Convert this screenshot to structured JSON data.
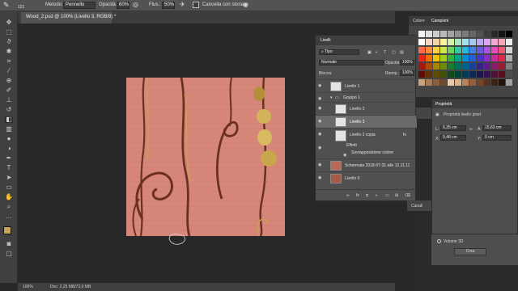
{
  "options_bar": {
    "tool_size": "121",
    "method_label": "Metodo:",
    "method_value": "Pennello",
    "opacity_label": "Opacità:",
    "opacity_value": "60%",
    "flow_label": "Flus.:",
    "flow_value": "50%",
    "history_label": "Cancella con storia"
  },
  "document": {
    "tab_title": "Wood_2.psd @ 100% (Livello 3, RGB/8) *",
    "zoom": "100%",
    "doc_info": "Doc: 2,25 MB/72,0 MB"
  },
  "layers_panel": {
    "title": "Livelli",
    "filter_label": "Tipo",
    "blend_mode": "Normale",
    "opacity_label": "Opacità:",
    "opacity_value": "100%",
    "fill_label": "Riemp.:",
    "fill_value": "100%",
    "lock_label": "Blocca:",
    "layers": [
      {
        "name": "Livello 1"
      },
      {
        "name": "Gruppo 1"
      },
      {
        "name": "Livello 2"
      },
      {
        "name": "Livello 3"
      },
      {
        "name": "Livello 2 copia"
      },
      {
        "name": "Effetti"
      },
      {
        "name": "Sovrapposizione colore"
      },
      {
        "name": "Schermata 2018-07-31 alle 12.11.11"
      },
      {
        "name": "Livello 0"
      }
    ],
    "fx_label": "fx"
  },
  "swatches_panel": {
    "tab_color": "Colore",
    "tab_swatches": "Campioni",
    "colors": {
      "row1": [
        "#f2f2f2",
        "#e0e0e0",
        "#cccccc",
        "#b8b8b8",
        "#a3a3a3",
        "#8f8f8f",
        "#7a7a7a",
        "#666666",
        "#525252",
        "#3d3d3d",
        "#292929",
        "#141414",
        "#000000"
      ],
      "row2": [
        "#ffffff",
        "#f5d5c5",
        "#f9d3a8",
        "#fbf3a1",
        "#d7f0a8",
        "#a8e5c2",
        "#a3e1ec",
        "#a8c6f2",
        "#b8a8f0",
        "#d8a8ef",
        "#f2a8d5",
        "#f5a8b3",
        "#ebebeb"
      ],
      "row3": [
        "#ff6b4a",
        "#ff8c35",
        "#ffd23b",
        "#cce842",
        "#6bd45d",
        "#35c8a3",
        "#2bb8e0",
        "#3f82e8",
        "#6b5ae0",
        "#a855e0",
        "#e44fb8",
        "#f05876",
        "#d4d4d4"
      ],
      "row4": [
        "#e8251a",
        "#ef6e00",
        "#f1c300",
        "#9fcf12",
        "#2fb53f",
        "#00a58a",
        "#0090cf",
        "#1f5fd8",
        "#4a35c8",
        "#8a2ec8",
        "#c92d98",
        "#e0284d",
        "#b0b0b0"
      ],
      "row5": [
        "#a31610",
        "#ad4a00",
        "#a88600",
        "#6b8e0a",
        "#1e7d2c",
        "#00705e",
        "#00628e",
        "#15419a",
        "#32248a",
        "#5d1e8a",
        "#891e68",
        "#9c1b35",
        "#7f7f7f"
      ],
      "row6": [
        "#5e0c08",
        "#633000",
        "#5e4c00",
        "#3f5406",
        "#114a1a",
        "#004237",
        "#003a54",
        "#0c265a",
        "#1c1550",
        "#371251",
        "#50123c",
        "#5a0f1f",
        "#4c4c4c"
      ],
      "row7": [
        "#c8a27a",
        "#a67c52",
        "#8b5e3c",
        "#6f4a2e",
        "#e8c9a8",
        "#d9b38c",
        "#b5845c",
        "#94603e",
        "#73462b",
        "#56331f",
        "#3b2314",
        "#20140b",
        "#a0a0a0"
      ]
    }
  },
  "properties_panel": {
    "title": "Proprietà",
    "subtitle": "Proprietà livello pixel",
    "l_label": "L:",
    "l_value": "6,35 cm",
    "a_label": "A:",
    "a_value": "15,63 cm",
    "x_label": "X:",
    "x_value": "0,48 cm",
    "y_label": "Y:",
    "y_value": "0 cm"
  },
  "side_collapsed": {
    "canali": "Canali"
  },
  "volume_panel": {
    "volume_label": "Volume 3D",
    "create_button": "Crea"
  },
  "accent": {
    "canvas_base": "#d7877a",
    "grain_dark": "#6b3022",
    "palette_yellow": "#d4b25a"
  }
}
